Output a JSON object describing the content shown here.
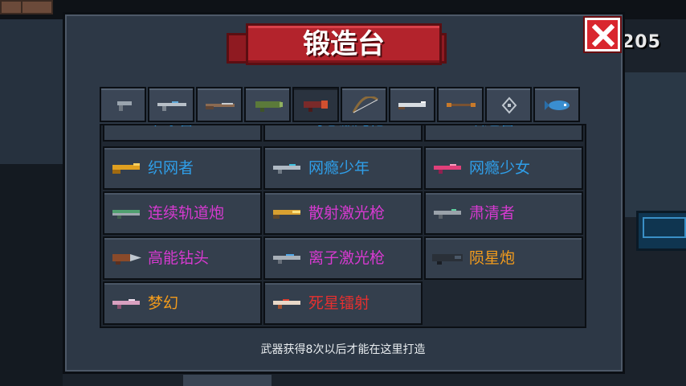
{
  "hud": {
    "score": "205"
  },
  "title": "锻造台",
  "close_icon": "close-x-icon",
  "tabs": [
    {
      "icon": "pistol-icon",
      "active": false
    },
    {
      "icon": "rifle-icon",
      "active": false
    },
    {
      "icon": "shotgun-icon",
      "active": false
    },
    {
      "icon": "launcher-icon",
      "active": false
    },
    {
      "icon": "laser-cannon-icon",
      "active": true
    },
    {
      "icon": "bow-icon",
      "active": false
    },
    {
      "icon": "blade-icon",
      "active": false
    },
    {
      "icon": "staff-icon",
      "active": false
    },
    {
      "icon": "crosshair-icon",
      "active": false
    },
    {
      "icon": "fish-gun-icon",
      "active": false
    }
  ],
  "weapons_partial_row": [
    {
      "name": "毕凉管",
      "color": "#2f9ee8"
    },
    {
      "name": "司忠激光枪",
      "color": "#2f9ee8"
    },
    {
      "name": "跃迁管",
      "color": "#2f9ee8"
    }
  ],
  "weapons": [
    {
      "name": "织网者",
      "color": "#2f9ee8",
      "icon": "golden-gun-icon"
    },
    {
      "name": "网瘾少年",
      "color": "#2f9ee8",
      "icon": "silver-gun-icon"
    },
    {
      "name": "网瘾少女",
      "color": "#2f9ee8",
      "icon": "pink-gun-icon"
    },
    {
      "name": "连续轨道炮",
      "color": "#d63ad0",
      "icon": "green-railgun-icon"
    },
    {
      "name": "散射激光枪",
      "color": "#d63ad0",
      "icon": "gold-laser-icon"
    },
    {
      "name": "肃清者",
      "color": "#d63ad0",
      "icon": "grey-gun-icon"
    },
    {
      "name": "高能钻头",
      "color": "#d63ad0",
      "icon": "drill-icon"
    },
    {
      "name": "离子激光枪",
      "color": "#d63ad0",
      "icon": "ion-gun-icon"
    },
    {
      "name": "陨星炮",
      "color": "#f29b1c",
      "icon": "dark-cannon-icon"
    },
    {
      "name": "梦幻",
      "color": "#f29b1c",
      "icon": "dream-gun-icon"
    },
    {
      "name": "死星镭射",
      "color": "#e53030",
      "icon": "deathstar-gun-icon"
    }
  ],
  "footer": "武器获得8次以后才能在这里打造"
}
